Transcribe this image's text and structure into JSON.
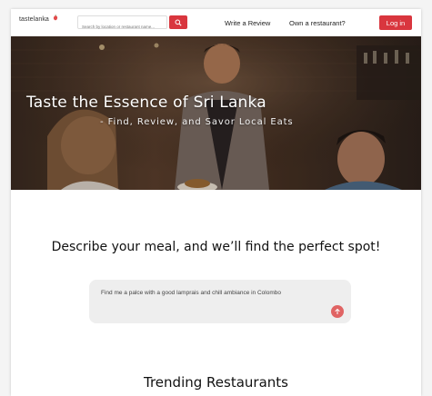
{
  "header": {
    "logo_text": "tastelanka",
    "search_placeholder": "Search by location or restaurant name...",
    "write_review": "Write a Review",
    "own_restaurant": "Own a restaurant?",
    "login": "Log in"
  },
  "hero": {
    "title": "Taste the Essence of Sri Lanka",
    "subtitle": "- Find, Review, and Savor Local Eats"
  },
  "describe": {
    "heading": "Describe your meal, and we’ll find the perfect spot!",
    "query_value": "Find me a palce with a good lamprais and chill ambiance in Colombo"
  },
  "trending": {
    "heading": "Trending Restaurants"
  },
  "colors": {
    "brand_red": "#d9363e",
    "send_button": "#e06464"
  },
  "icons": {
    "search": "search-icon",
    "send": "arrow-up-icon",
    "logo": "pepper-icon"
  }
}
